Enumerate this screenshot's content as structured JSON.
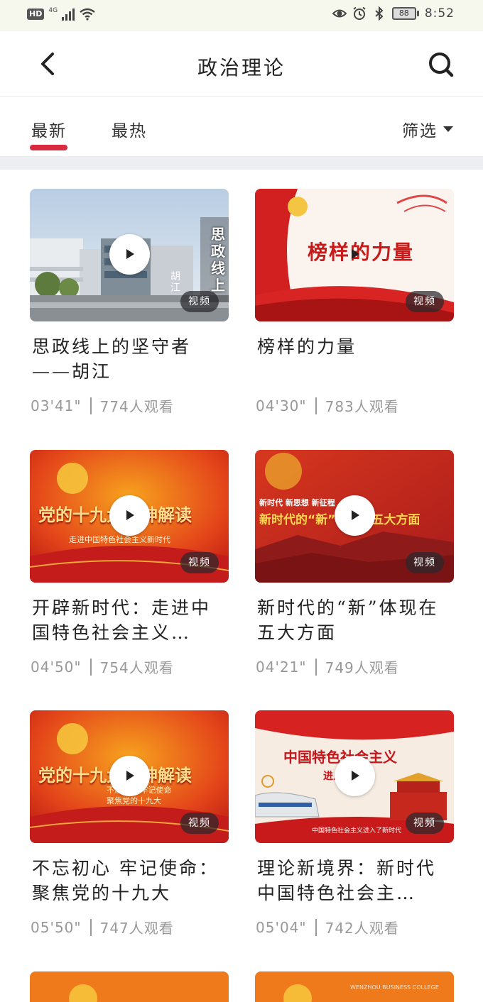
{
  "status_bar": {
    "hd": "HD",
    "network": "4G",
    "battery": "88",
    "time": "8:52"
  },
  "header": {
    "title": "政治理论",
    "back_icon": "chevron-left-icon",
    "search_icon": "search-icon"
  },
  "tabs": {
    "latest": "最新",
    "hot": "最热",
    "filter": "筛选",
    "active_color": "#d9293f"
  },
  "badge_label": "视频",
  "cards": [
    {
      "title": "思政线上的坚守者——胡江",
      "duration": "03'41\"",
      "views": "774人观看"
    },
    {
      "title": "榜样的力量",
      "duration": "04'30\"",
      "views": "783人观看"
    },
    {
      "title": "开辟新时代：走进中国特色社会主义…",
      "duration": "04'50\"",
      "views": "754人观看"
    },
    {
      "title": "新时代的“新”体现在五大方面",
      "duration": "04'21\"",
      "views": "749人观看"
    },
    {
      "title": "不忘初心 牢记使命：聚焦党的十九大",
      "duration": "05'50\"",
      "views": "747人观看"
    },
    {
      "title": "理论新境界：新时代中国特色社会主…",
      "duration": "05'04\"",
      "views": "742人观看"
    }
  ],
  "thumb_texts": {
    "t1_vertical": "思政线上",
    "t1_name": "胡江",
    "t2_main": "榜样的力量",
    "t3_main": "党的十九大精神解读",
    "t3_sub": "走进中国特色社会主义新时代",
    "t4_top": "新时代 新思想 新征程",
    "t4_main": "新时代的“新”体现在五大方面",
    "t5_main": "党的十九大精神解读",
    "t5_sub1": "不忘初心 牢记使命",
    "t5_sub2": "聚焦党的十九大",
    "t6_main": "中国特色社会主义",
    "t6_sub": "进入新时代",
    "t6_bottom": "中国特色社会主义进入了新时代",
    "watermark": "WENZHOU BUSINESS COLLEGE"
  }
}
